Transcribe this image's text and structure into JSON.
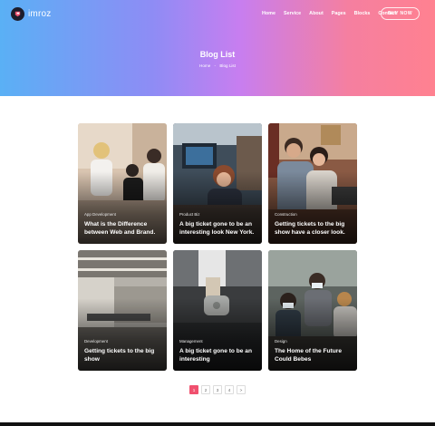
{
  "header": {
    "logo_text": "imroz",
    "nav": [
      "Home",
      "Service",
      "About",
      "Pages",
      "Blocks",
      "Contact"
    ],
    "buy_label": "BUY NOW"
  },
  "hero": {
    "title": "Blog List",
    "breadcrumb": {
      "home": "Home",
      "separator": "-",
      "current": "Blog List"
    }
  },
  "posts": [
    {
      "category": "App Development",
      "title": "What is the Difference between Web and Brand."
    },
    {
      "category": "Product Biz",
      "title": "A big ticket gone to be an interesting look New York."
    },
    {
      "category": "Construction",
      "title": "Getting tickets to the big show have a closer look."
    },
    {
      "category": "Development",
      "title": "Getting tickets to the big show"
    },
    {
      "category": "Management",
      "title": "A big ticket gone to be an interesting"
    },
    {
      "category": "Design",
      "title": "The Home of the Future Could Bebes"
    }
  ],
  "pagination": {
    "pages": [
      "1",
      "2",
      "3",
      "4",
      ">"
    ],
    "active_index": 0
  },
  "colors": {
    "accent": "#f0506e",
    "gradient_start": "#5ab0f5",
    "gradient_end": "#ff8190"
  }
}
